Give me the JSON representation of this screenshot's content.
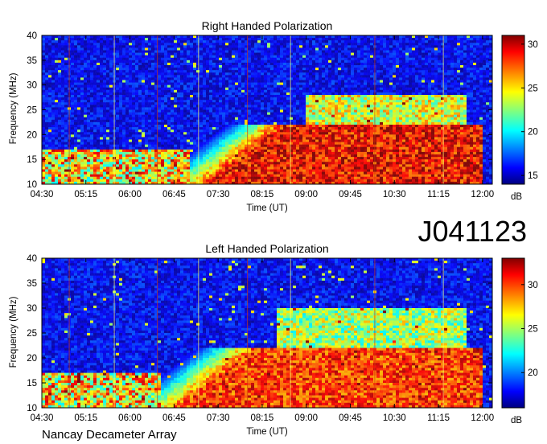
{
  "figure": {
    "observation_id": "J041123",
    "instrument": "Nancay Decameter Array",
    "colors": {
      "background": "#ffffff",
      "axis": "#000000"
    }
  },
  "chart_data": [
    {
      "type": "heatmap",
      "title": "Right Handed Polarization",
      "xlabel": "Time (UT)",
      "ylabel": "Frequency (MHz)",
      "x_tick_labels": [
        "04:30",
        "05:15",
        "06:00",
        "06:45",
        "07:30",
        "08:15",
        "09:00",
        "09:45",
        "10:30",
        "11:15",
        "12:00"
      ],
      "x_range_minutes": [
        270,
        730
      ],
      "y_ticks": [
        10,
        15,
        20,
        25,
        30,
        35,
        40
      ],
      "ylim": [
        10,
        40
      ],
      "colorbar": {
        "label": "dB",
        "ticks": [
          15,
          20,
          25,
          30
        ],
        "range": [
          14,
          31
        ],
        "colormap": "jet"
      },
      "emission_features": [
        {
          "description": "Intense low-frequency emission band",
          "freq_mhz": [
            10,
            22
          ],
          "time_from": "07:00",
          "time_to": "12:00",
          "level_db": 30
        },
        {
          "description": "Moderate emission band",
          "freq_mhz": [
            22,
            28
          ],
          "time_from": "09:00",
          "time_to": "11:45",
          "level_db": 24
        },
        {
          "description": "Quiet background",
          "freq_mhz": [
            25,
            40
          ],
          "time_from": "04:30",
          "time_to": "08:30",
          "level_db": 16
        }
      ]
    },
    {
      "type": "heatmap",
      "title": "Left Handed Polarization",
      "xlabel": "Time (UT)",
      "ylabel": "Frequency (MHz)",
      "x_tick_labels": [
        "04:30",
        "05:15",
        "06:00",
        "06:45",
        "07:30",
        "08:15",
        "09:00",
        "09:45",
        "10:30",
        "11:15",
        "12:00"
      ],
      "x_range_minutes": [
        270,
        730
      ],
      "y_ticks": [
        10,
        15,
        20,
        25,
        30,
        35,
        40
      ],
      "ylim": [
        10,
        40
      ],
      "colorbar": {
        "label": "dB",
        "ticks": [
          20,
          25,
          30
        ],
        "range": [
          16,
          33
        ],
        "colormap": "jet"
      },
      "emission_features": [
        {
          "description": "Intense low-frequency emission band",
          "freq_mhz": [
            10,
            22
          ],
          "time_from": "06:30",
          "time_to": "12:00",
          "level_db": 31
        },
        {
          "description": "Moderate emission band",
          "freq_mhz": [
            20,
            30
          ],
          "time_from": "08:30",
          "time_to": "11:45",
          "level_db": 25
        },
        {
          "description": "Quiet background",
          "freq_mhz": [
            25,
            40
          ],
          "time_from": "04:30",
          "time_to": "08:30",
          "level_db": 18
        }
      ]
    }
  ]
}
